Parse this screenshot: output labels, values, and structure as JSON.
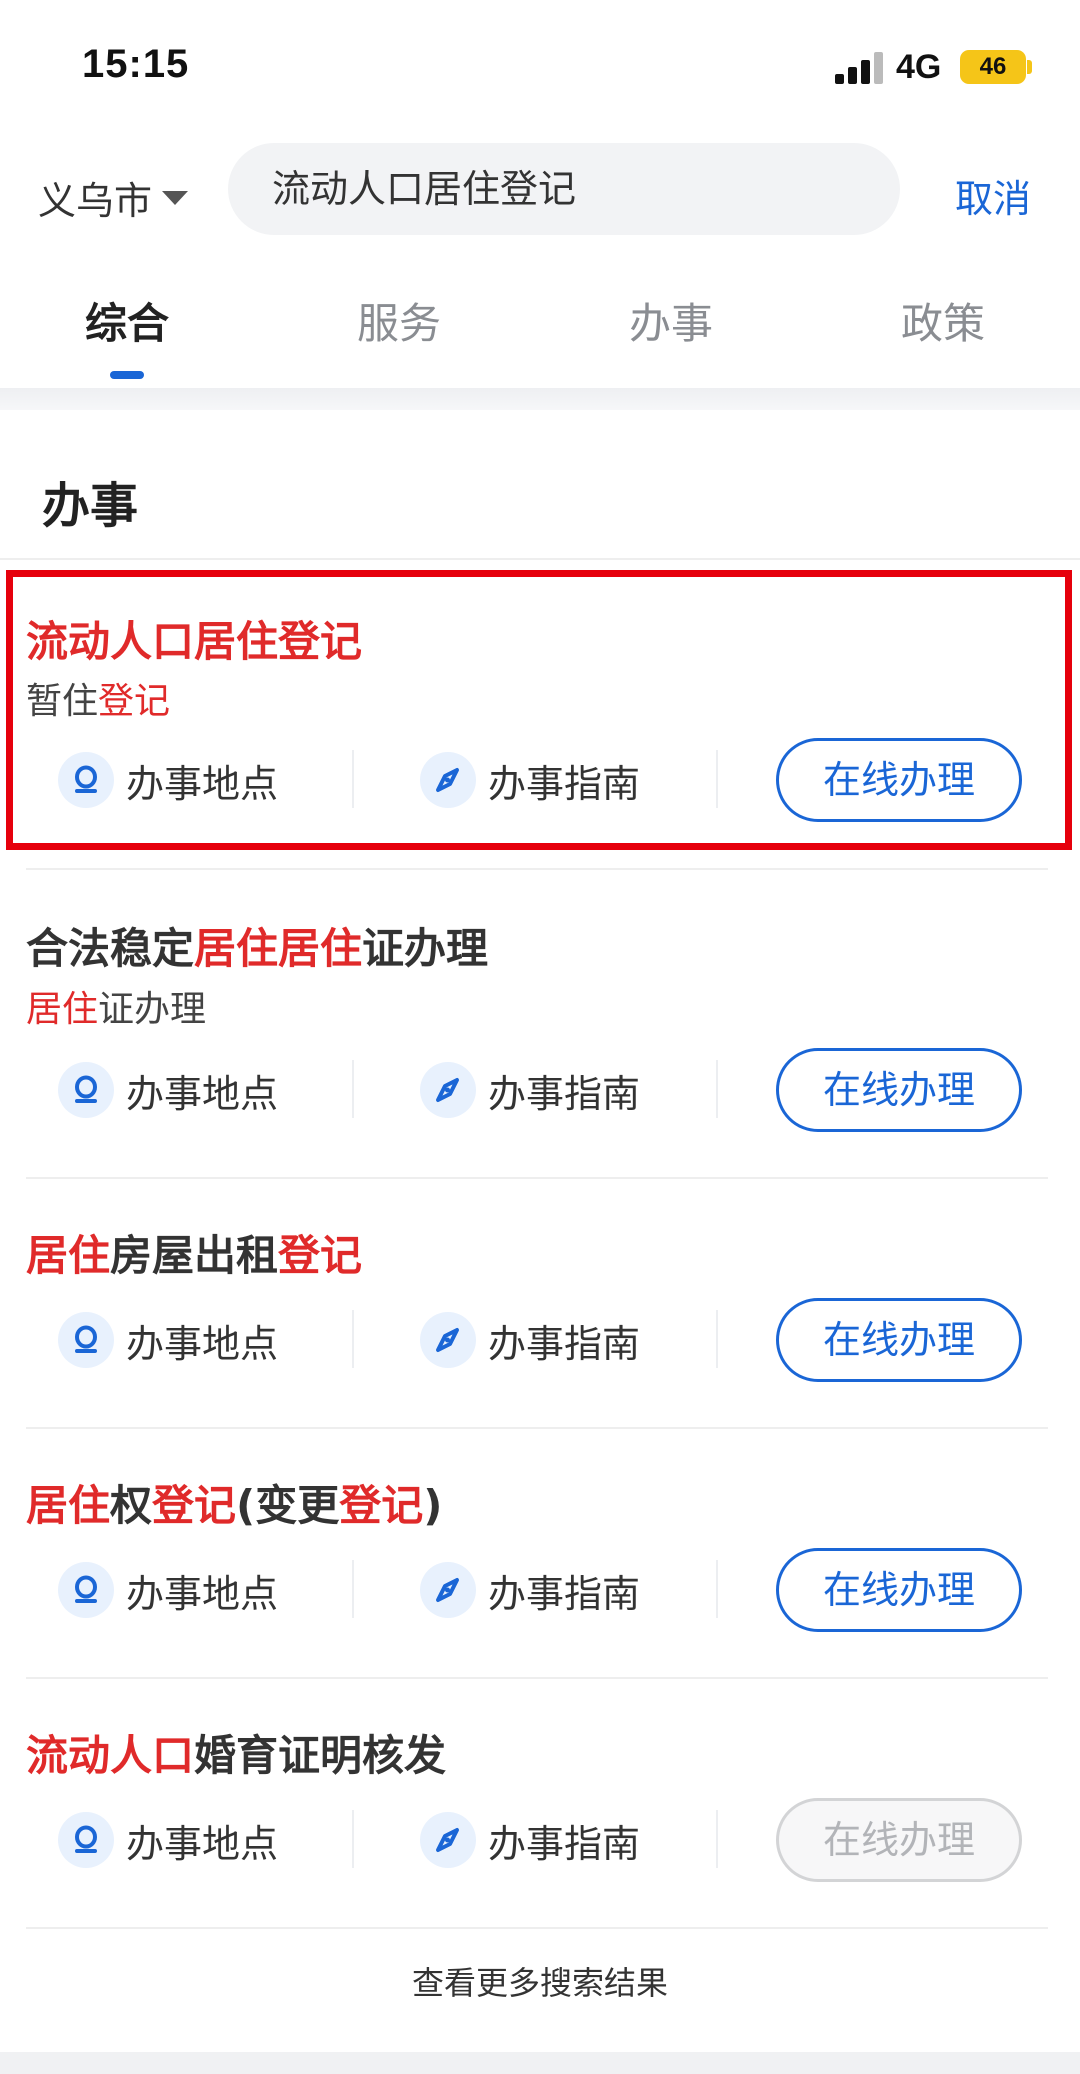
{
  "status_bar": {
    "time": "15:15",
    "network": "4G",
    "battery": "46"
  },
  "search_bar": {
    "city": "义乌市",
    "query": "流动人口居住登记",
    "cancel_label": "取消"
  },
  "tabs": [
    {
      "label": "综合",
      "active": true
    },
    {
      "label": "服务",
      "active": false
    },
    {
      "label": "办事",
      "active": false
    },
    {
      "label": "政策",
      "active": false
    }
  ],
  "section": {
    "title": "办事"
  },
  "results": [
    {
      "title_parts": [
        {
          "text": "流动人口居住登记",
          "hl": true
        }
      ],
      "subtitle_parts": [
        {
          "text": "暂住",
          "hl": false
        },
        {
          "text": "登记",
          "hl": true
        }
      ],
      "location_label": "办事地点",
      "guide_label": "办事指南",
      "online_label": "在线办理",
      "online_enabled": true
    },
    {
      "title_parts": [
        {
          "text": "合法稳定",
          "hl": false
        },
        {
          "text": "居住居住",
          "hl": true
        },
        {
          "text": "证办理",
          "hl": false
        }
      ],
      "subtitle_parts": [
        {
          "text": "居住",
          "hl": true
        },
        {
          "text": "证办理",
          "hl": false
        }
      ],
      "location_label": "办事地点",
      "guide_label": "办事指南",
      "online_label": "在线办理",
      "online_enabled": true
    },
    {
      "title_parts": [
        {
          "text": "居住",
          "hl": true
        },
        {
          "text": "房屋出租",
          "hl": false
        },
        {
          "text": "登记",
          "hl": true
        }
      ],
      "subtitle_parts": [],
      "location_label": "办事地点",
      "guide_label": "办事指南",
      "online_label": "在线办理",
      "online_enabled": true
    },
    {
      "title_parts": [
        {
          "text": "居住",
          "hl": true
        },
        {
          "text": "权",
          "hl": false
        },
        {
          "text": "登记",
          "hl": true
        },
        {
          "text": "(变更",
          "hl": false
        },
        {
          "text": "登记",
          "hl": true
        },
        {
          "text": ")",
          "hl": false
        }
      ],
      "subtitle_parts": [],
      "location_label": "办事地点",
      "guide_label": "办事指南",
      "online_label": "在线办理",
      "online_enabled": true
    },
    {
      "title_parts": [
        {
          "text": "流动人口",
          "hl": true
        },
        {
          "text": "婚育证明核发",
          "hl": false
        }
      ],
      "subtitle_parts": [],
      "location_label": "办事地点",
      "guide_label": "办事指南",
      "online_label": "在线办理",
      "online_enabled": false
    }
  ],
  "more_label": "查看更多搜索结果",
  "colors": {
    "accent": "#1a66d6",
    "highlight": "#e02a2a",
    "annotation_box": "#e6000c"
  },
  "icons": {
    "location": "location-pin-icon",
    "guide": "compass-icon",
    "city_dropdown": "caret-down-icon"
  }
}
